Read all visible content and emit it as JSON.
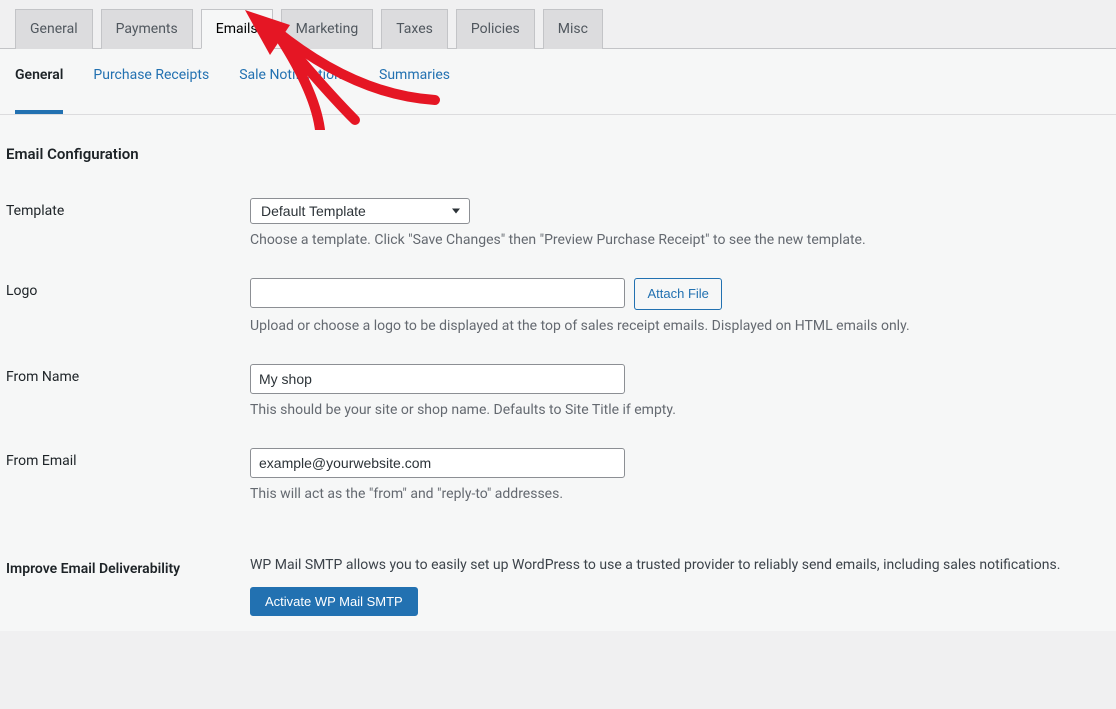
{
  "tabs": {
    "main": [
      {
        "label": "General",
        "active": false
      },
      {
        "label": "Payments",
        "active": false
      },
      {
        "label": "Emails",
        "active": true
      },
      {
        "label": "Marketing",
        "active": false
      },
      {
        "label": "Taxes",
        "active": false
      },
      {
        "label": "Policies",
        "active": false
      },
      {
        "label": "Misc",
        "active": false
      }
    ],
    "sub": [
      {
        "label": "General",
        "current": true
      },
      {
        "label": "Purchase Receipts",
        "current": false
      },
      {
        "label": "Sale Notifications",
        "current": false
      },
      {
        "label": "Summaries",
        "current": false
      }
    ]
  },
  "section_title": "Email Configuration",
  "fields": {
    "template": {
      "label": "Template",
      "value": "Default Template",
      "description": "Choose a template. Click \"Save Changes\" then \"Preview Purchase Receipt\" to see the new template."
    },
    "logo": {
      "label": "Logo",
      "value": "",
      "button": "Attach File",
      "description": "Upload or choose a logo to be displayed at the top of sales receipt emails. Displayed on HTML emails only."
    },
    "from_name": {
      "label": "From Name",
      "value": "My shop",
      "description": "This should be your site or shop name. Defaults to Site Title if empty."
    },
    "from_email": {
      "label": "From Email",
      "value": "example@yourwebsite.com",
      "description": "This will act as the \"from\" and \"reply-to\" addresses."
    },
    "deliverability": {
      "label": "Improve Email Deliverability",
      "description": "WP Mail SMTP allows you to easily set up WordPress to use a trusted provider to reliably send emails, including sales notifications.",
      "button": "Activate WP Mail SMTP"
    }
  }
}
